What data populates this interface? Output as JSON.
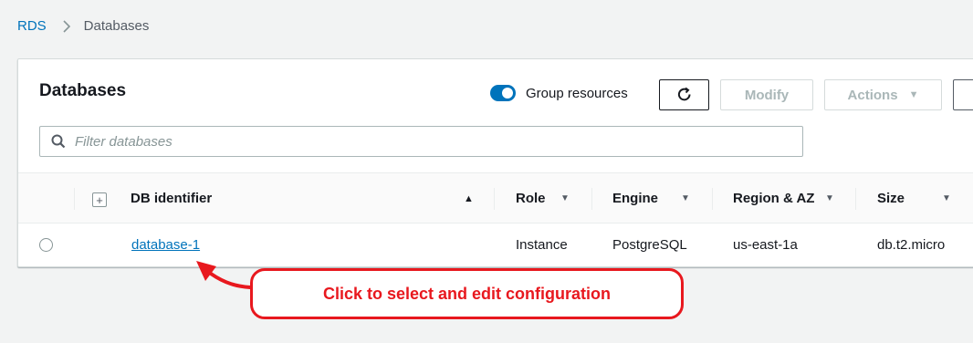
{
  "breadcrumb": {
    "root": "RDS",
    "current": "Databases"
  },
  "panel": {
    "title": "Databases",
    "group_resources_label": "Group resources",
    "group_resources_enabled": true,
    "modify_label": "Modify",
    "actions_label": "Actions",
    "search_placeholder": "Filter databases"
  },
  "table": {
    "columns": [
      "DB identifier",
      "Role",
      "Engine",
      "Region & AZ",
      "Size"
    ],
    "rows": [
      {
        "db_identifier": "database-1",
        "role": "Instance",
        "engine": "PostgreSQL",
        "region_az": "us-east-1a",
        "size": "db.t2.micro"
      }
    ]
  },
  "annotation": {
    "text": "Click to select and edit configuration"
  },
  "colors": {
    "accent": "#0073bb",
    "annotation": "#e8181e",
    "background": "#f2f3f3"
  }
}
